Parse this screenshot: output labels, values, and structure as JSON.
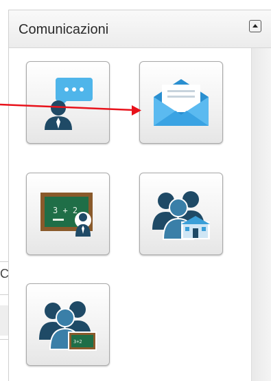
{
  "panel": {
    "title": "Comunicazioni",
    "collapse_icon": "triangle-up-icon"
  },
  "background": {
    "partial_text": "C"
  },
  "tiles": [
    {
      "icon": "person-chat-icon"
    },
    {
      "icon": "open-envelope-icon"
    },
    {
      "icon": "blackboard-student-icon"
    },
    {
      "icon": "group-school-icon"
    },
    {
      "icon": "group-blackboard-icon"
    }
  ],
  "annotation": {
    "arrow_color": "#e8121b",
    "target": "open-envelope-icon"
  },
  "colors": {
    "icon_dark": "#1f4a66",
    "icon_blue": "#3a9fd8",
    "bubble": "#4fb5ea",
    "board_green": "#1f6e47",
    "board_frame": "#8a5a2b"
  }
}
